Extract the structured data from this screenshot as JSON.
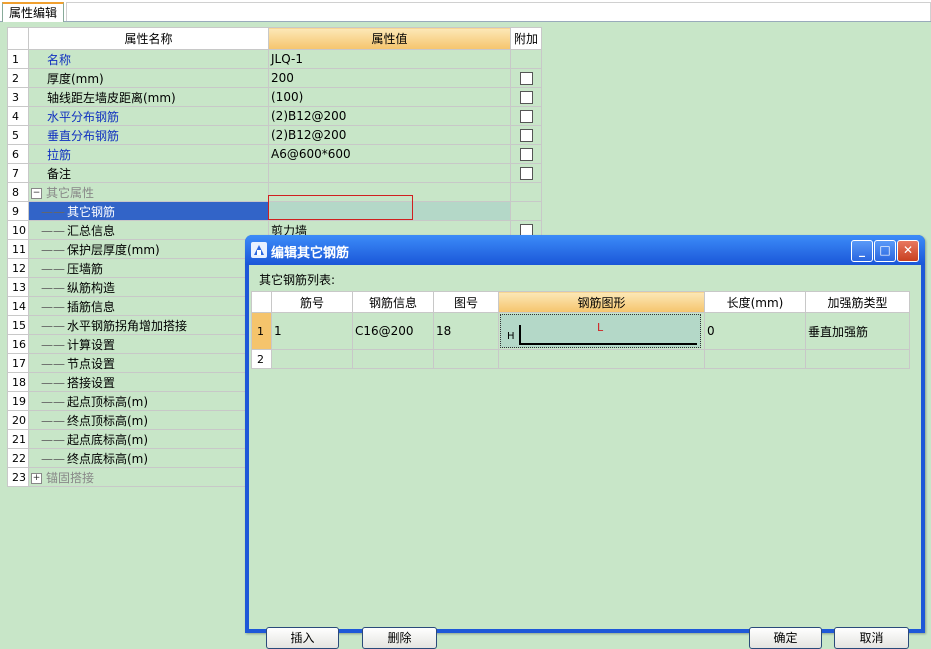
{
  "tab": {
    "label": "属性编辑"
  },
  "prop_grid": {
    "headers": {
      "name": "属性名称",
      "value": "属性值",
      "extra": "附加"
    },
    "rows": [
      {
        "no": "1",
        "name": "名称",
        "value": "JLQ-1",
        "style": "blue",
        "check": false
      },
      {
        "no": "2",
        "name": "厚度(mm)",
        "value": "200",
        "style": "",
        "check": true
      },
      {
        "no": "3",
        "name": "轴线距左墙皮距离(mm)",
        "value": "(100)",
        "style": "",
        "check": true
      },
      {
        "no": "4",
        "name": "水平分布钢筋",
        "value": "(2)B12@200",
        "style": "blue",
        "check": true
      },
      {
        "no": "5",
        "name": "垂直分布钢筋",
        "value": "(2)B12@200",
        "style": "blue",
        "check": true
      },
      {
        "no": "6",
        "name": "拉筋",
        "value": "A6@600*600",
        "style": "blue",
        "check": true
      },
      {
        "no": "7",
        "name": "备注",
        "value": "",
        "style": "",
        "check": true
      },
      {
        "no": "8",
        "name": "其它属性",
        "value": "",
        "style": "gray",
        "check": false
      },
      {
        "no": "9",
        "name": "其它钢筋",
        "value": "",
        "style": "",
        "check": false
      },
      {
        "no": "10",
        "name": "汇总信息",
        "value": "剪力墙",
        "style": "",
        "check": true
      },
      {
        "no": "11",
        "name": "保护层厚度(mm)",
        "value": "",
        "style": "",
        "check": false
      },
      {
        "no": "12",
        "name": "压墙筋",
        "value": "",
        "style": "",
        "check": false
      },
      {
        "no": "13",
        "name": "纵筋构造",
        "value": "",
        "style": "",
        "check": false
      },
      {
        "no": "14",
        "name": "插筋信息",
        "value": "",
        "style": "",
        "check": false
      },
      {
        "no": "15",
        "name": "水平钢筋拐角增加搭接",
        "value": "",
        "style": "",
        "check": false
      },
      {
        "no": "16",
        "name": "计算设置",
        "value": "",
        "style": "",
        "check": false
      },
      {
        "no": "17",
        "name": "节点设置",
        "value": "",
        "style": "",
        "check": false
      },
      {
        "no": "18",
        "name": "搭接设置",
        "value": "",
        "style": "",
        "check": false
      },
      {
        "no": "19",
        "name": "起点顶标高(m)",
        "value": "",
        "style": "",
        "check": false
      },
      {
        "no": "20",
        "name": "终点顶标高(m)",
        "value": "",
        "style": "",
        "check": false
      },
      {
        "no": "21",
        "name": "起点底标高(m)",
        "value": "",
        "style": "",
        "check": false
      },
      {
        "no": "22",
        "name": "终点底标高(m)",
        "value": "",
        "style": "",
        "check": false
      },
      {
        "no": "23",
        "name": "锚固搭接",
        "value": "",
        "style": "gray",
        "check": false
      }
    ],
    "expand_minus": "−",
    "expand_plus": "+"
  },
  "dialog": {
    "title": "编辑其它钢筋",
    "list_label": "其它钢筋列表:",
    "headers": {
      "bar_no": "筋号",
      "rebar_info": "钢筋信息",
      "figure_no": "图号",
      "shape": "钢筋图形",
      "length": "长度(mm)",
      "type": "加强筋类型"
    },
    "rows": [
      {
        "no": "1",
        "bar_no": "1",
        "rebar_info": "C16@200",
        "figure_no": "18",
        "shape_h": "H",
        "shape_l": "L",
        "length": "0",
        "type": "垂直加强筋"
      },
      {
        "no": "2",
        "bar_no": "",
        "rebar_info": "",
        "figure_no": "",
        "shape_h": "",
        "shape_l": "",
        "length": "",
        "type": ""
      }
    ],
    "buttons": {
      "insert": "插入",
      "delete": "删除",
      "ok": "确定",
      "cancel": "取消"
    },
    "window_buttons": {
      "minimize": "_",
      "maximize": "□",
      "close": "✕"
    }
  }
}
